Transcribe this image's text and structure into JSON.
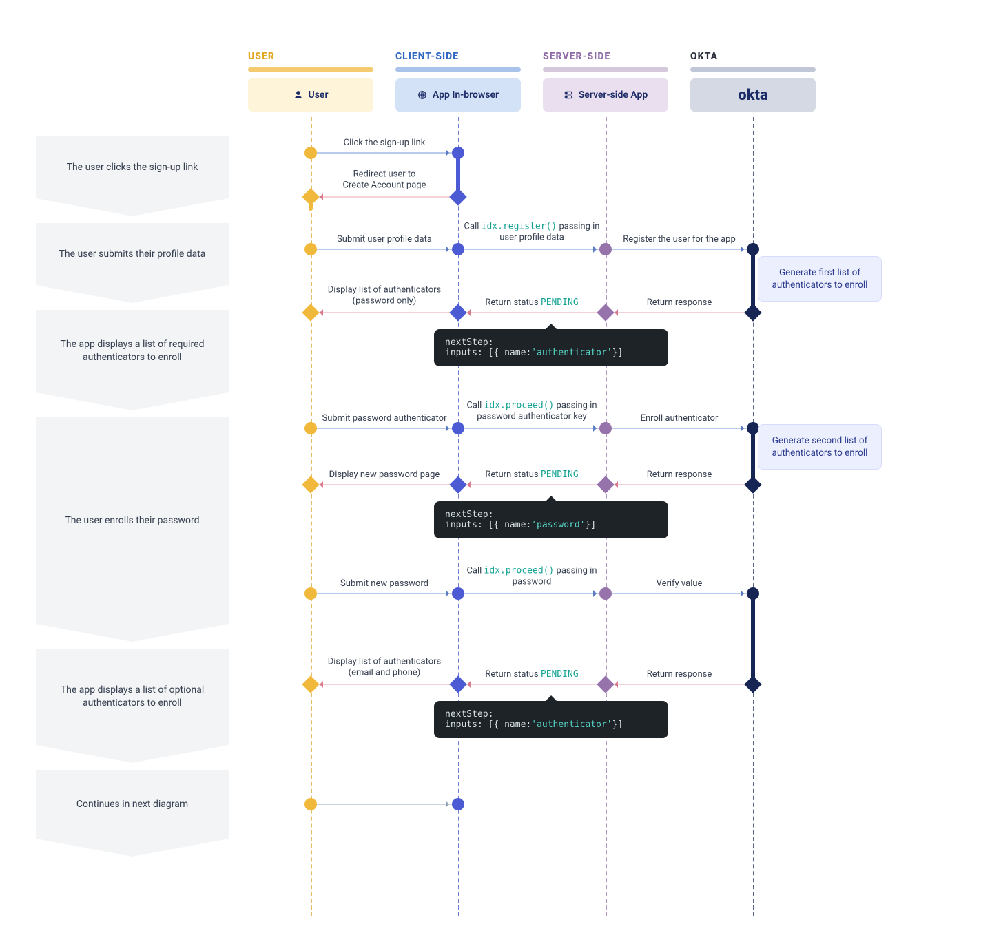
{
  "lanes": {
    "user": {
      "title": "USER",
      "head": "User"
    },
    "client": {
      "title": "CLIENT-SIDE",
      "head": "App In-browser"
    },
    "server": {
      "title": "SERVER-SIDE",
      "head": "Server-side App"
    },
    "okta": {
      "title": "OKTA",
      "head": "okta"
    }
  },
  "steps": {
    "s1": "The user clicks the sign-up link",
    "s2": "The user submits their profile data",
    "s3": "The app displays a list of required authenticators to enroll",
    "s4": "The user enrolls their password",
    "s5": "The app displays a list of optional authenticators to enroll",
    "s6": "Continues in next diagram"
  },
  "messages": {
    "m1": "Click the sign-up link",
    "m2": "Redirect user to\nCreate Account page",
    "m3": "Submit user profile data",
    "m4a": "Call ",
    "m4c": "idx.register()",
    "m4b": " passing in\nuser profile data",
    "m5": "Register the user for the app",
    "m6": "Return response",
    "m7a": "Return status ",
    "m7c": "PENDING",
    "m8": "Display list of authenticators\n(password only)",
    "m9": "Submit password authenticator",
    "m10a": "Call ",
    "m10c": "idx.proceed()",
    "m10b": " passing in\npassword authenticator key",
    "m11": "Enroll authenticator",
    "m12": "Return response",
    "m13a": "Return status ",
    "m13c": "PENDING",
    "m14": "Display new password page",
    "m15": "Submit new password",
    "m16a": "Call ",
    "m16c": "idx.proceed()",
    "m16b": " passing in\npassword",
    "m17": "Verify value",
    "m18": "Return response",
    "m19a": "Return status ",
    "m19c": "PENDING",
    "m20": "Display list of authenticators\n(email and phone)"
  },
  "bubbles": {
    "b1": "Generate first list of authenticators to enroll",
    "b2": "Generate second list of authenticators to enroll"
  },
  "code": {
    "c1a": "nextStep:",
    "c1b": "  inputs: [{ name:",
    "c1c": "'authenticator'",
    "c1d": "}]",
    "c2a": "nextStep:",
    "c2b": "  inputs: [{ name:",
    "c2c": "'password'",
    "c2d": "}]",
    "c3a": "nextStep:",
    "c3b": "  inputs: [{ name:",
    "c3c": "'authenticator'",
    "c3d": "}]"
  }
}
